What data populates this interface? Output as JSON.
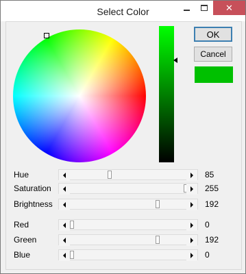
{
  "window": {
    "title": "Select Color",
    "close_glyph": "✕",
    "minimize_icon": "minimize-icon",
    "maximize_icon": "maximize-icon"
  },
  "buttons": {
    "ok": "OK",
    "cancel": "Cancel"
  },
  "preview_color": "#00c000",
  "sliders": [
    {
      "key": "hue",
      "label": "Hue",
      "value": "85",
      "fraction": 0.333
    },
    {
      "key": "saturation",
      "label": "Saturation",
      "value": "255",
      "fraction": 1.0
    },
    {
      "key": "brightness",
      "label": "Brightness",
      "value": "192",
      "fraction": 0.753
    },
    {
      "key": "red",
      "label": "Red",
      "value": "0",
      "fraction": 0.0
    },
    {
      "key": "green",
      "label": "Green",
      "value": "192",
      "fraction": 0.753
    },
    {
      "key": "blue",
      "label": "Blue",
      "value": "0",
      "fraction": 0.0
    }
  ],
  "colors": {
    "brightness_top": "#00ff00",
    "brightness_bottom": "#000000",
    "close_button": "#c7505a",
    "ok_border": "#3c7fb1"
  }
}
